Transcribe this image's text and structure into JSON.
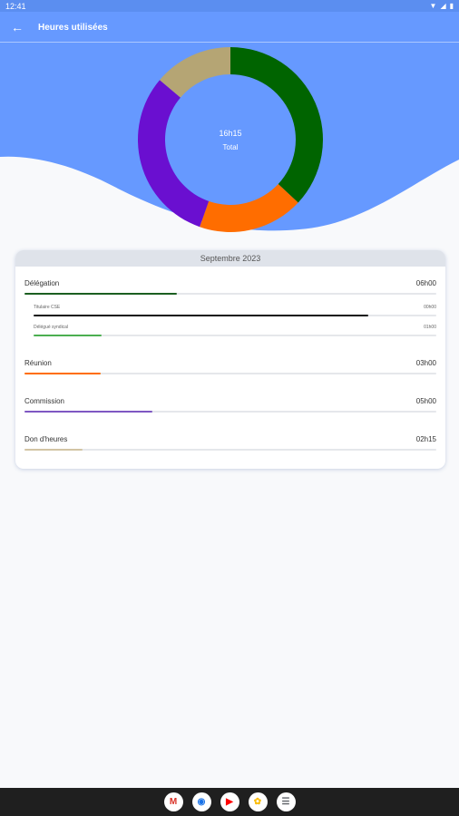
{
  "status": {
    "time": "12:41"
  },
  "app_bar": {
    "title": "Heures utilisées"
  },
  "chart_data": {
    "type": "pie",
    "center_value": "16h15",
    "center_label": "Total",
    "segments": [
      {
        "label": "Délégation",
        "value": 6,
        "color": "#006400"
      },
      {
        "label": "Réunion",
        "value": 3,
        "color": "#ff6d00"
      },
      {
        "label": "Commission",
        "value": 5,
        "color": "#6a0fd0"
      },
      {
        "label": "Don d'heures",
        "value": 2.25,
        "color": "#b5a574"
      }
    ]
  },
  "card": {
    "month": "Septembre 2023",
    "rows": [
      {
        "label": "Délégation",
        "value": "06h00",
        "fraction": 0.37,
        "color": "#1b5e20"
      },
      {
        "label": "Réunion",
        "value": "03h00",
        "fraction": 0.185,
        "color": "#ff6d00"
      },
      {
        "label": "Commission",
        "value": "05h00",
        "fraction": 0.31,
        "color": "#7e57c2"
      },
      {
        "label": "Don d'heures",
        "value": "02h15",
        "fraction": 0.14,
        "color": "#d2c4a4"
      }
    ],
    "sub_rows": [
      {
        "label": "Titulaire CSE",
        "value": "00h00",
        "fraction": 0.83,
        "color": "#111111"
      },
      {
        "label": "Délégué syndical",
        "value": "01h00",
        "fraction": 0.17,
        "color": "#4caf50"
      }
    ]
  },
  "dock": [
    {
      "name": "gmail-icon",
      "glyph": "M",
      "color": "#d93025"
    },
    {
      "name": "chrome-icon",
      "glyph": "◉",
      "color": "#1a73e8"
    },
    {
      "name": "youtube-icon",
      "glyph": "▶",
      "color": "#ff0000"
    },
    {
      "name": "photos-icon",
      "glyph": "✿",
      "color": "#fbbc04"
    },
    {
      "name": "app-drawer-icon",
      "glyph": "☰",
      "color": "#5f6368"
    }
  ]
}
